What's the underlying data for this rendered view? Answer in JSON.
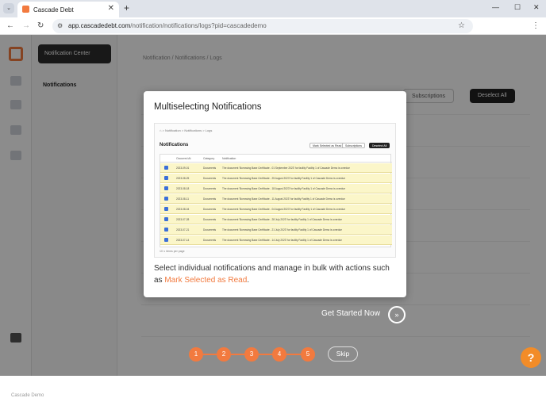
{
  "browser": {
    "tab_title": "Cascade Debt",
    "url_host": "app.cascadedebt.com",
    "url_path": "/notification/notifications/logs?pid=cascadedemo"
  },
  "app": {
    "sidebar_header": "Notification Center",
    "sidebar_item": "Notifications",
    "breadcrumb": "Notification   /   Notifications   /   Logs",
    "subscriptions_label": "Subscriptions",
    "deselect_label": "Deselect All",
    "bottom_user": "Cascade Demo"
  },
  "modal": {
    "title": "Multiselecting Notifications",
    "description_prefix": "Select individual notifications and manage in bulk with actions such as ",
    "description_highlight": "Mark Selected as Read",
    "description_suffix": ".",
    "preview": {
      "breadcrumb": "⌂  >  Notification  >  Notifications  >  Logs",
      "title": "Notifications",
      "btn_mark": "Mark Selected as Read",
      "btn_subs": "Subscriptions",
      "btn_deselect": "Deselect All",
      "columns": [
        "Occurred At",
        "Category",
        "Notification"
      ],
      "rows": [
        {
          "date": "2023-09-01",
          "cat": "Documents",
          "text": "The document 'Borrowing Base Certificate - 01 September 2023' for facility Facility 1 of Cascade Demo is overdue"
        },
        {
          "date": "2023-08-25",
          "cat": "Documents",
          "text": "The document 'Borrowing Base Certificate - 25 August 2023' for facility Facility 1 of Cascade Demo is overdue"
        },
        {
          "date": "2023-08-18",
          "cat": "Documents",
          "text": "The document 'Borrowing Base Certificate - 18 August 2023' for facility Facility 1 of Cascade Demo is overdue"
        },
        {
          "date": "2023-08-11",
          "cat": "Documents",
          "text": "The document 'Borrowing Base Certificate - 11 August 2023' for facility Facility 1 of Cascade Demo is overdue"
        },
        {
          "date": "2023-08-04",
          "cat": "Documents",
          "text": "The document 'Borrowing Base Certificate - 04 August 2023' for facility Facility 1 of Cascade Demo is overdue"
        },
        {
          "date": "2023-07-28",
          "cat": "Documents",
          "text": "The document 'Borrowing Base Certificate - 28 July 2023' for facility Facility 1 of Cascade Demo is overdue"
        },
        {
          "date": "2023-07-21",
          "cat": "Documents",
          "text": "The document 'Borrowing Base Certificate - 21 July 2023' for facility Facility 1 of Cascade Demo is overdue"
        },
        {
          "date": "2023-07-14",
          "cat": "Documents",
          "text": "The document 'Borrowing Base Certificate - 14 July 2023' for facility Facility 1 of Cascade Demo is overdue"
        }
      ],
      "footer": "10  ∨   items per page"
    }
  },
  "tour": {
    "get_started": "Get Started Now",
    "steps": [
      "1",
      "2",
      "3",
      "4",
      "5"
    ],
    "skip": "Skip",
    "help": "?"
  },
  "colors": {
    "accent": "#f27a3f",
    "help": "#f28c28"
  }
}
